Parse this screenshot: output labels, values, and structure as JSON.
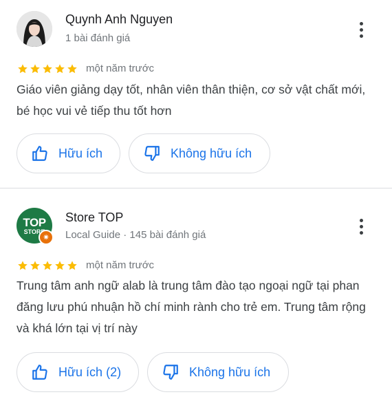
{
  "reviews": [
    {
      "author": "Quynh Anh Nguyen",
      "meta": "1 bài đánh giá",
      "time": "một năm trước",
      "rating": 5,
      "text": "Giáo viên giảng dạy tốt, nhân viên thân thiện, cơ sở vật chất mới, bé học vui vẻ tiếp thu tốt hơn",
      "helpful_label": "Hữu ích",
      "not_helpful_label": "Không hữu ích"
    },
    {
      "author": "Store TOP",
      "meta": "Local Guide · 145 bài đánh giá",
      "time": "một năm trước",
      "rating": 5,
      "text": "Trung tâm anh ngữ alab là trung tâm đào tạo ngoại ngữ tại phan đăng lưu phú nhuận hồ chí minh rành cho trẻ em. Trung tâm rộng và khá lớn tại vị trí này",
      "helpful_label": "Hữu ích (2)",
      "not_helpful_label": "Không hữu ích",
      "avatar_logo_line1": "TOP",
      "avatar_logo_line2": "STORE"
    }
  ],
  "colors": {
    "star": "#fbbc04",
    "link_blue": "#1a73e8",
    "logo_green": "#1e7a45",
    "guide_badge": "#e8710a"
  },
  "icons": {
    "more": "more-vert-icon",
    "helpful": "thumb-up-icon",
    "not_helpful": "thumb-down-icon",
    "rating": "star-icon",
    "local_guide": "local-guide-badge-icon"
  }
}
